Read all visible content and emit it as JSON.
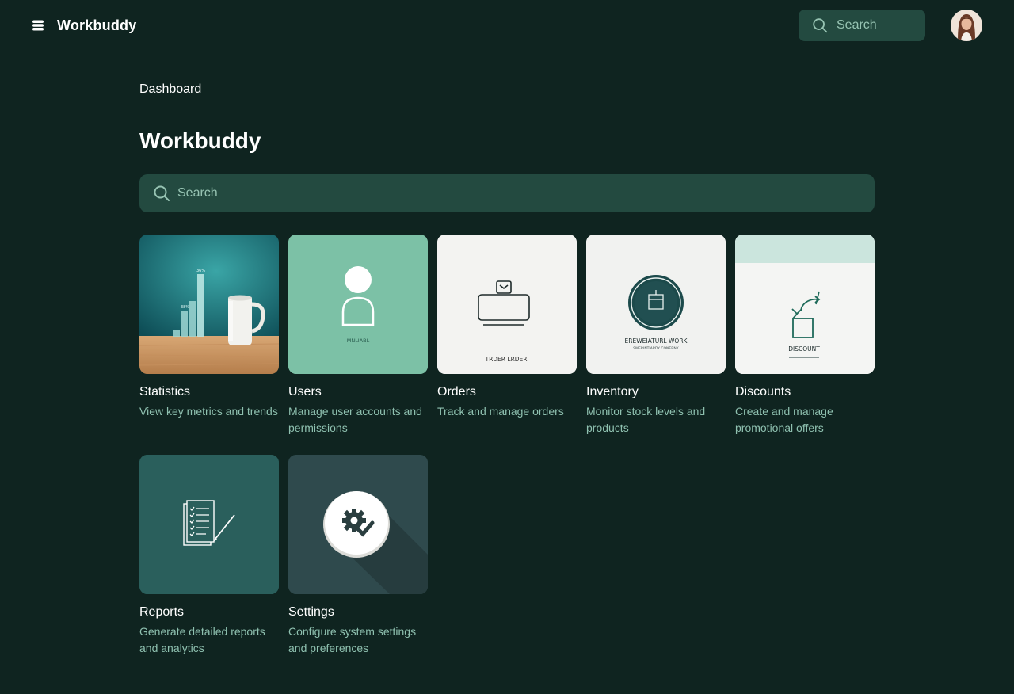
{
  "header": {
    "brand": "Workbuddy",
    "search_placeholder": "Search"
  },
  "breadcrumb": "Dashboard",
  "page_title": "Workbuddy",
  "main_search_placeholder": "Search",
  "cards": [
    {
      "title": "Statistics",
      "description": "View key metrics and trends",
      "chart_label_1": "36%",
      "chart_label_2": "38%"
    },
    {
      "title": "Users",
      "description": "Manage user accounts and permissions",
      "thumb_caption": "MNLIABL"
    },
    {
      "title": "Orders",
      "description": "Track and manage orders",
      "thumb_caption": "TRDER LRDER"
    },
    {
      "title": "Inventory",
      "description": "Monitor stock levels and products",
      "thumb_caption": "EREWEIATURL WORK",
      "thumb_subcaption": "SMERINTIARDY CONERNK"
    },
    {
      "title": "Discounts",
      "description": "Create and manage promotional offers",
      "thumb_caption": "DISCOUNT"
    },
    {
      "title": "Reports",
      "description": "Generate detailed reports and analytics"
    },
    {
      "title": "Settings",
      "description": "Configure system settings and preferences"
    }
  ],
  "colors": {
    "background": "#0f2420",
    "search_bg": "#234a40",
    "muted_text": "#8fc1b0",
    "users_thumb": "#7cc1a6",
    "reports_thumb": "#2a5f5c",
    "settings_thumb": "#2f4a4d"
  },
  "icons": {
    "brand": "stack-icon",
    "search": "search-icon"
  }
}
